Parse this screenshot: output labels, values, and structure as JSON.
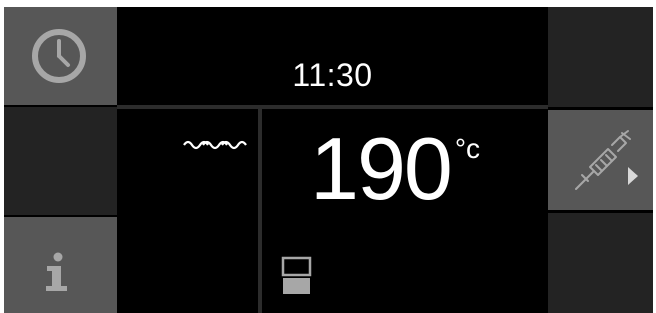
{
  "clock": {
    "time": "11:30",
    "icon": "clock-icon"
  },
  "temperature": {
    "value": "190",
    "unit": "°c"
  },
  "icons": {
    "info": "info-icon",
    "probe": "meat-probe-icon",
    "heating_mode": "wave-heating-icon",
    "door_lock": "door-lock-icon"
  },
  "colors": {
    "background": "#000000",
    "tile_active": "#575757",
    "tile_inactive": "#232323",
    "text": "#ffffff",
    "icon_grey": "#a7a7a7"
  }
}
